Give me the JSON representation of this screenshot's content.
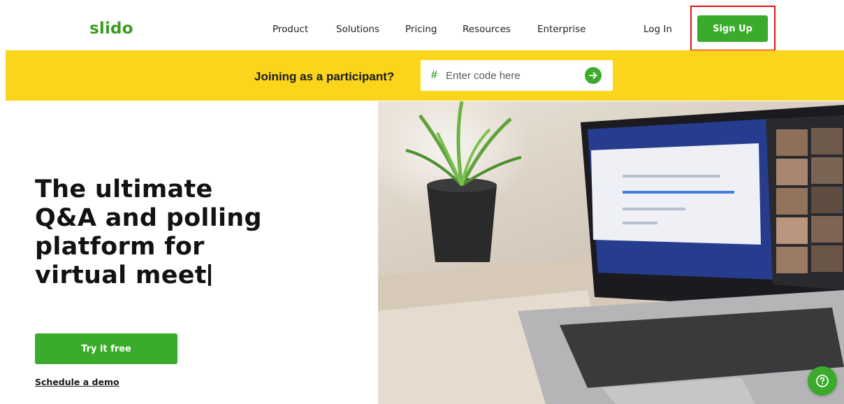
{
  "brand": {
    "logo_text": "slido",
    "accent": "#3aab2a",
    "banner_color": "#fbd51c"
  },
  "nav": {
    "links": [
      {
        "label": "Product"
      },
      {
        "label": "Solutions"
      },
      {
        "label": "Pricing"
      },
      {
        "label": "Resources"
      },
      {
        "label": "Enterprise"
      }
    ],
    "login_label": "Log In",
    "signup_label": "Sign Up"
  },
  "join": {
    "label": "Joining as a participant?",
    "hash_symbol": "#",
    "placeholder": "Enter code here",
    "submit_icon": "arrow-right-icon"
  },
  "hero": {
    "title_lines": [
      "The ultimate",
      "Q&A and polling",
      "platform for",
      "virtual meet"
    ],
    "cta_label": "Try it free",
    "demo_label": "Schedule a demo",
    "image_subject": "laptop-video-call-photo"
  },
  "help": {
    "icon": "help-question-icon"
  }
}
